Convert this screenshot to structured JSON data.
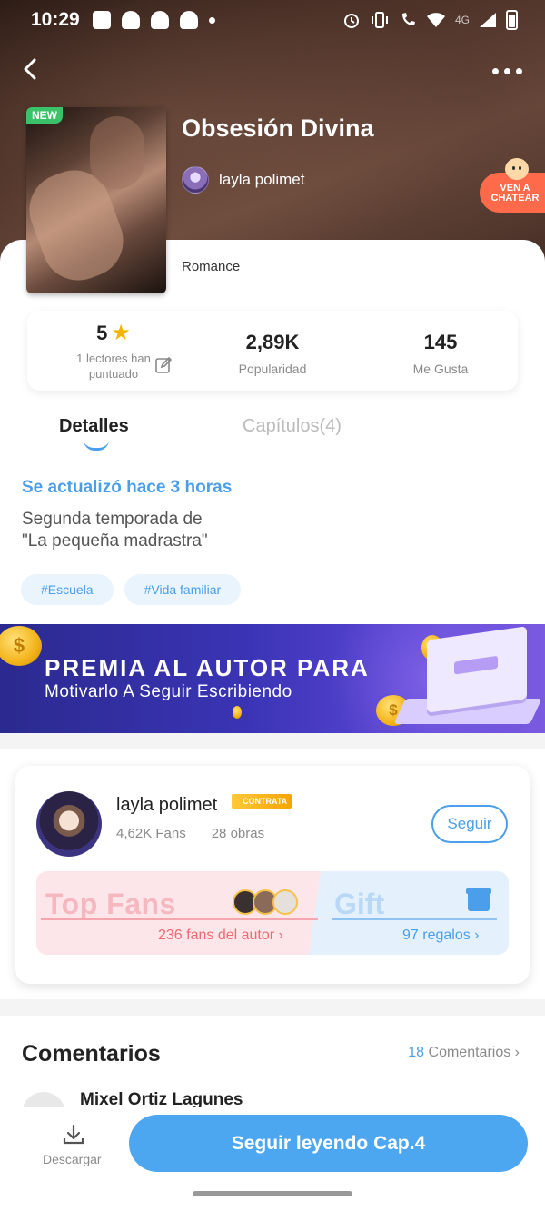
{
  "status_bar": {
    "time": "10:29",
    "network": "4G"
  },
  "book": {
    "badge": "NEW",
    "title": "Obsesión Divina",
    "author": "layla polimet",
    "genre": "Romance"
  },
  "chat_badge": {
    "line1": "VEN A",
    "line2": "CHATEAR"
  },
  "stats": {
    "rating": "5",
    "rating_label": "1 lectores han puntuado",
    "popularity_value": "2,89K",
    "popularity_label": "Popularidad",
    "likes_value": "145",
    "likes_label": "Me Gusta"
  },
  "tabs": {
    "details": "Detalles",
    "chapters": "Capítulos(4)"
  },
  "details": {
    "updated": "Se actualizó hace 3 horas",
    "synopsis": "Segunda temporada de\n\"La pequeña madrastra\"",
    "tags": [
      "#Escuela",
      "#Vida familiar"
    ]
  },
  "banner": {
    "line1": "PREMIA AL AUTOR PARA",
    "line2": "Motivarlo A Seguir Escribiendo"
  },
  "author_card": {
    "name": "layla polimet",
    "badge": "CONTRATA",
    "fans": "4,62K Fans",
    "works": "28 obras",
    "follow": "Seguir",
    "top_fans_title": "Top Fans",
    "top_fans_count": "236 fans del autor",
    "gift_title": "Gift",
    "gift_count": "97 regalos"
  },
  "comments": {
    "title": "Comentarios",
    "count": "18",
    "count_label": "Comentarios",
    "first_commenter": "Mixel Ortiz Lagunes"
  },
  "bottom": {
    "download": "Descargar",
    "read_button": "Seguir leyendo Cap.4"
  },
  "colors": {
    "accent": "#4a9eea",
    "new_badge": "#3ac26a",
    "chat_badge": "#ff6b4a",
    "star": "#f5b400"
  }
}
